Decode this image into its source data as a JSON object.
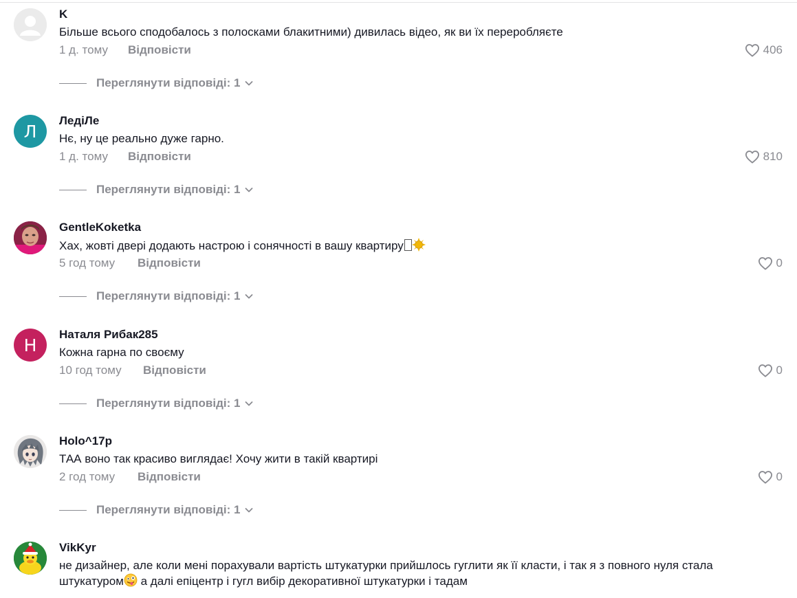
{
  "ui": {
    "reply_label": "Відповісти",
    "view_replies_label": "Переглянути відповіді: 1"
  },
  "colors": {
    "text_primary": "#161823",
    "text_secondary": "#8a8b91",
    "avatar_teal": "#1e98a3",
    "avatar_magenta": "#c4215e"
  },
  "comments": [
    {
      "username": "K",
      "text": "Більше всього сподобалось з полосками блакитними) дивилась відео, як ви їх переробляєте",
      "time": "1 д. тому",
      "likes": "406",
      "avatar": "default-user-icon"
    },
    {
      "username": "ЛедіЛе",
      "text": "Нє, ну це реально дуже гарно.",
      "time": "1 д. тому",
      "likes": "810",
      "avatar_letter": "Л"
    },
    {
      "username": "GentleKoketka",
      "text": "Хах, жовті двері додають настрою і сонячності в вашу квартиру",
      "text_emoji": "sun-emoji",
      "time": "5 год тому",
      "likes": "0",
      "avatar": "profile-photo"
    },
    {
      "username": "Наталя Рибак285",
      "text": "Кожна гарна по своєму",
      "time": "10 год тому",
      "likes": "0",
      "avatar_letter": "Н"
    },
    {
      "username": "Holo^17p",
      "text": "ТАА воно так красиво виглядає! Хочу жити в такій квартирі",
      "time": "2 год тому",
      "likes": "0",
      "avatar": "anime-avatar"
    },
    {
      "username": "VikKyr",
      "text_part1": "не дизайнер, але коли мені порахували вартість штукатурки прийшлось гуглити як її класти, і так я з повного нуля стала штукатуром",
      "text_emoji": "goofy-face-emoji",
      "text_part2": " а далі епіцентр і гугл вибір декоративної штукатурки і тадам",
      "avatar": "duck-avatar"
    }
  ]
}
